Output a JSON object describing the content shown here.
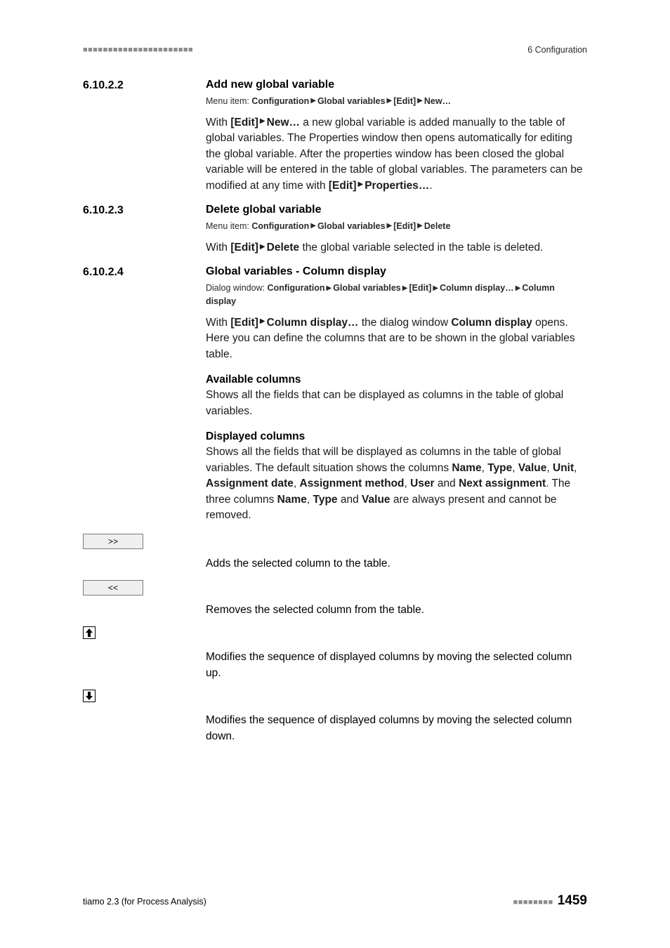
{
  "header": {
    "dots": "■■■■■■■■■■■■■■■■■■■■■■",
    "chapter": "6 Configuration"
  },
  "sections": [
    {
      "number": "6.10.2.2",
      "title": "Add new global variable",
      "menu_prefix": "Menu item: ",
      "path": [
        "Configuration",
        "Global variables",
        "[Edit]",
        "New…"
      ],
      "body_parts": {
        "p1a": "With ",
        "p1b": "[Edit]",
        "p1c": "New…",
        "p1d": " a new global variable is added manually to the table of global variables. The Properties window then opens automatically for editing the global variable. After the properties window has been closed the global variable will be entered in the table of global variables. The parameters can be modified at any time with ",
        "p1e": "[Edit]",
        "p1f": "Properties…",
        "p1g": "."
      }
    },
    {
      "number": "6.10.2.3",
      "title": "Delete global variable",
      "menu_prefix": "Menu item: ",
      "path": [
        "Configuration",
        "Global variables",
        "[Edit]",
        "Delete"
      ],
      "body_parts": {
        "p1a": "With ",
        "p1b": "[Edit]",
        "p1c": "Delete",
        "p1d": " the global variable selected in the table is deleted."
      }
    },
    {
      "number": "6.10.2.4",
      "title": "Global variables - Column display",
      "menu_prefix": "Dialog window: ",
      "path": [
        "Configuration",
        "Global variables",
        "[Edit]",
        "Column display…",
        "Column display"
      ],
      "body_parts": {
        "p1a": "With ",
        "p1b": "[Edit]",
        "p1c": "Column display…",
        "p1d": " the dialog window ",
        "p1e": "Column display",
        "p1f": " opens. Here you can define the columns that are to be shown in the global variables table."
      },
      "sub1_title": "Available columns",
      "sub1_body": "Shows all the fields that can be displayed as columns in the table of global variables.",
      "sub2_title": "Displayed columns",
      "sub2_body_parts": {
        "a": "Shows all the fields that will be displayed as columns in the table of global variables. The default situation shows the columns ",
        "cols1": [
          "Name",
          "Type",
          "Value",
          "Unit",
          "Assignment date",
          "Assignment method",
          "User"
        ],
        "and1": " and ",
        "next": "Next assignment",
        "b": ". The three columns ",
        "cols2": [
          "Name",
          "Type"
        ],
        "and2": " and ",
        "val": "Value",
        "c": " are always present and cannot be removed."
      },
      "actions": {
        "add_label": ">>",
        "add_desc": "Adds the selected column to the table.",
        "remove_label": "<<",
        "remove_desc": "Removes the selected column from the table.",
        "up_desc": "Modifies the sequence of displayed columns by moving the selected column up.",
        "down_desc": "Modifies the sequence of displayed columns by moving the selected column down."
      }
    }
  ],
  "footer": {
    "left": "tiamo 2.3 (for Process Analysis)",
    "dots": "■■■■■■■■",
    "page": "1459"
  }
}
